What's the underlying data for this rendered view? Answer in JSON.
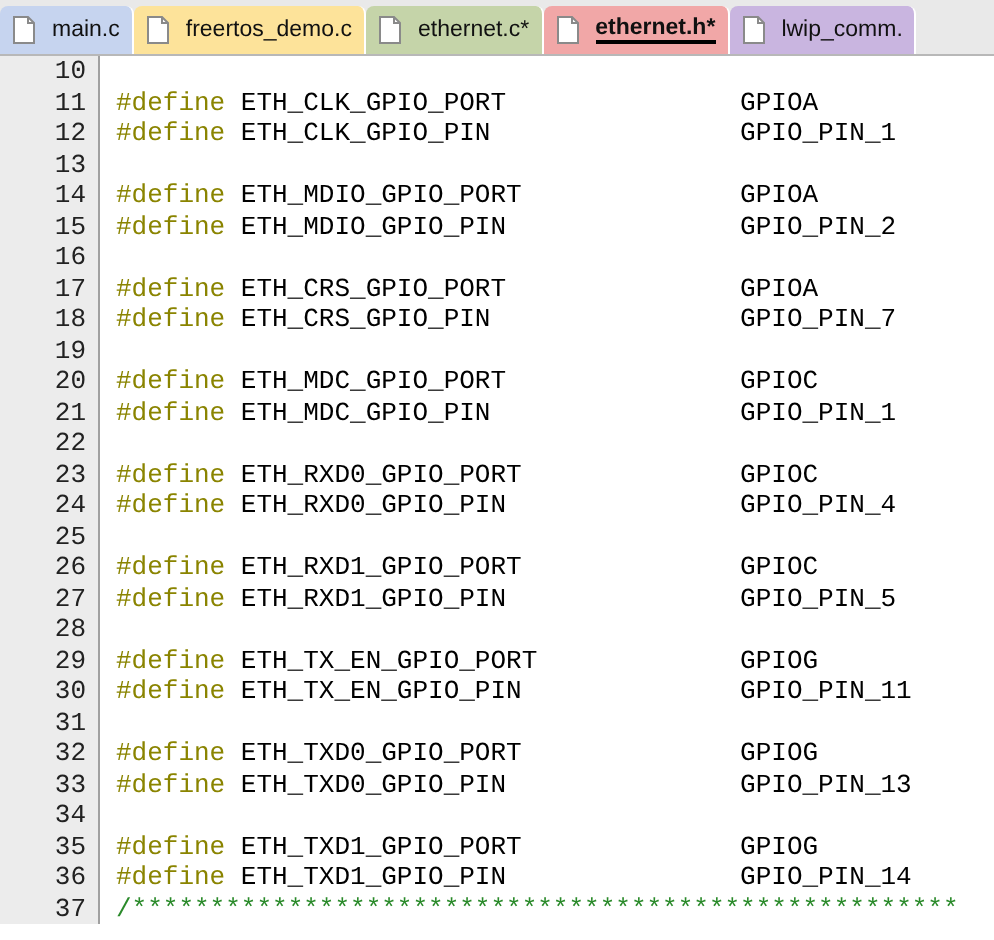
{
  "tabs": [
    {
      "label": "main.c",
      "color": "#c6d4ef",
      "selected": false
    },
    {
      "label": "freertos_demo.c",
      "color": "#fde39a",
      "selected": false
    },
    {
      "label": "ethernet.c*",
      "color": "#c5d4a9",
      "selected": false
    },
    {
      "label": "ethernet.h*",
      "color": "#f1a7a7",
      "selected": true
    },
    {
      "label": "lwip_comm.",
      "color": "#c9b5e0",
      "selected": false
    }
  ],
  "lines": [
    {
      "number": "10",
      "kind": "blank"
    },
    {
      "number": "11",
      "kind": "define",
      "keyword": "#define",
      "name": "ETH_CLK_GPIO_PORT",
      "value": "GPIOA"
    },
    {
      "number": "12",
      "kind": "define",
      "keyword": "#define",
      "name": "ETH_CLK_GPIO_PIN",
      "value": "GPIO_PIN_1"
    },
    {
      "number": "13",
      "kind": "blank"
    },
    {
      "number": "14",
      "kind": "define",
      "keyword": "#define",
      "name": "ETH_MDIO_GPIO_PORT",
      "value": "GPIOA"
    },
    {
      "number": "15",
      "kind": "define",
      "keyword": "#define",
      "name": "ETH_MDIO_GPIO_PIN",
      "value": "GPIO_PIN_2"
    },
    {
      "number": "16",
      "kind": "blank"
    },
    {
      "number": "17",
      "kind": "define",
      "keyword": "#define",
      "name": "ETH_CRS_GPIO_PORT",
      "value": "GPIOA"
    },
    {
      "number": "18",
      "kind": "define",
      "keyword": "#define",
      "name": "ETH_CRS_GPIO_PIN",
      "value": "GPIO_PIN_7"
    },
    {
      "number": "19",
      "kind": "blank"
    },
    {
      "number": "20",
      "kind": "define",
      "keyword": "#define",
      "name": "ETH_MDC_GPIO_PORT",
      "value": "GPIOC"
    },
    {
      "number": "21",
      "kind": "define",
      "keyword": "#define",
      "name": "ETH_MDC_GPIO_PIN",
      "value": "GPIO_PIN_1"
    },
    {
      "number": "22",
      "kind": "blank"
    },
    {
      "number": "23",
      "kind": "define",
      "keyword": "#define",
      "name": "ETH_RXD0_GPIO_PORT",
      "value": "GPIOC"
    },
    {
      "number": "24",
      "kind": "define",
      "keyword": "#define",
      "name": "ETH_RXD0_GPIO_PIN",
      "value": "GPIO_PIN_4"
    },
    {
      "number": "25",
      "kind": "blank"
    },
    {
      "number": "26",
      "kind": "define",
      "keyword": "#define",
      "name": "ETH_RXD1_GPIO_PORT",
      "value": "GPIOC"
    },
    {
      "number": "27",
      "kind": "define",
      "keyword": "#define",
      "name": "ETH_RXD1_GPIO_PIN",
      "value": "GPIO_PIN_5"
    },
    {
      "number": "28",
      "kind": "blank"
    },
    {
      "number": "29",
      "kind": "define",
      "keyword": "#define",
      "name": "ETH_TX_EN_GPIO_PORT",
      "value": "GPIOG"
    },
    {
      "number": "30",
      "kind": "define",
      "keyword": "#define",
      "name": "ETH_TX_EN_GPIO_PIN",
      "value": "GPIO_PIN_11"
    },
    {
      "number": "31",
      "kind": "blank"
    },
    {
      "number": "32",
      "kind": "define",
      "keyword": "#define",
      "name": "ETH_TXD0_GPIO_PORT",
      "value": "GPIOG"
    },
    {
      "number": "33",
      "kind": "define",
      "keyword": "#define",
      "name": "ETH_TXD0_GPIO_PIN",
      "value": "GPIO_PIN_13"
    },
    {
      "number": "34",
      "kind": "blank"
    },
    {
      "number": "35",
      "kind": "define",
      "keyword": "#define",
      "name": "ETH_TXD1_GPIO_PORT",
      "value": "GPIOG"
    },
    {
      "number": "36",
      "kind": "define",
      "keyword": "#define",
      "name": "ETH_TXD1_GPIO_PIN",
      "value": "GPIO_PIN_14"
    },
    {
      "number": "37",
      "kind": "comment",
      "text": "/*****************************************************"
    }
  ]
}
